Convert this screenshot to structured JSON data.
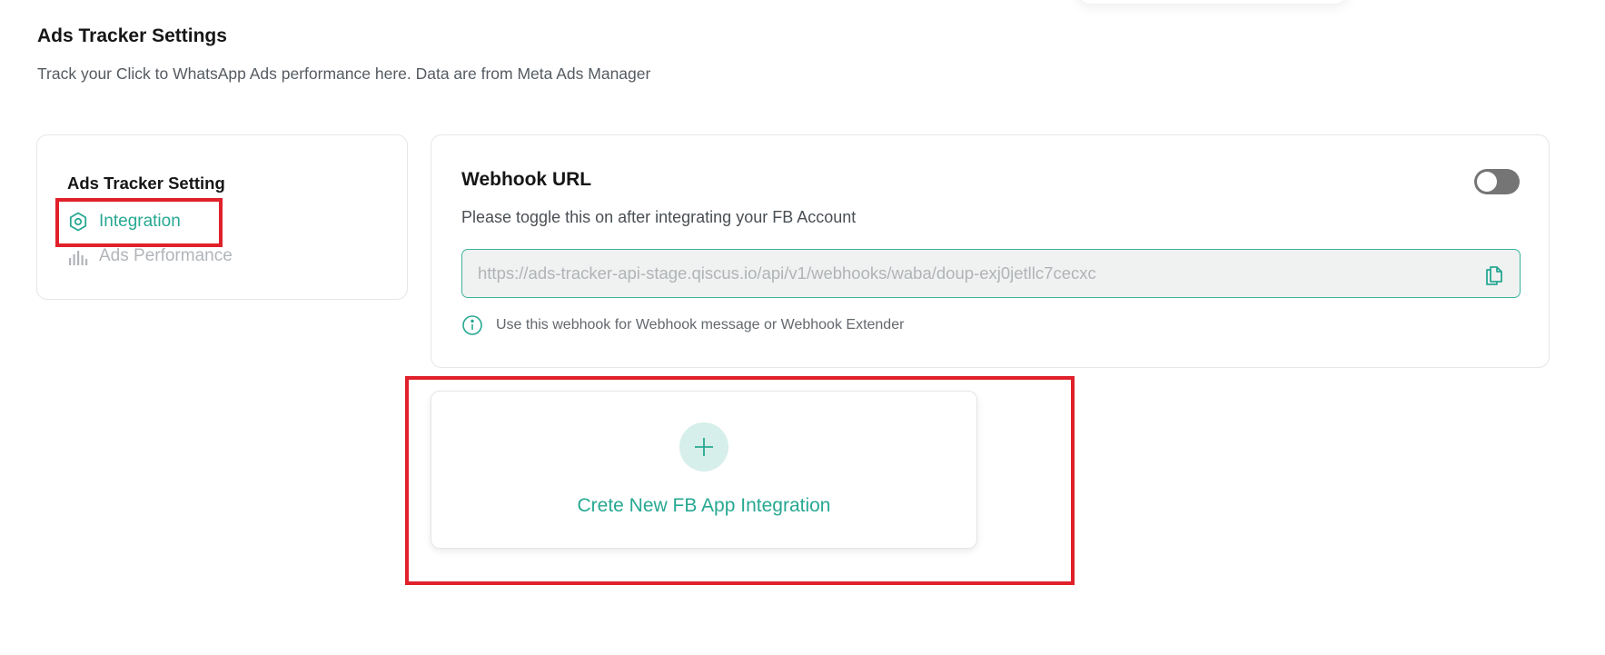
{
  "header": {
    "title": "Ads Tracker Settings",
    "subtitle": "Track your Click to WhatsApp Ads performance here. Data are from Meta Ads Manager"
  },
  "sidebar": {
    "heading": "Ads Tracker Setting",
    "items": [
      {
        "label": "Integration",
        "icon": "hexagon-gear-icon",
        "active": true
      },
      {
        "label": "Ads Performance",
        "icon": "bar-chart-icon",
        "active": false
      }
    ]
  },
  "webhook": {
    "title": "Webhook URL",
    "toggle_on": false,
    "description": "Please toggle this on after integrating your FB Account",
    "url_placeholder": "https://ads-tracker-api-stage.qiscus.io/api/v1/webhooks/waba/doup-exj0jetllc7cecxc",
    "hint": "Use this webhook for Webhook message or Webhook Extender"
  },
  "create": {
    "label": "Crete New FB App Integration"
  },
  "colors": {
    "accent": "#27a892",
    "highlight": "#e0202a",
    "toggle_off": "#757575"
  }
}
